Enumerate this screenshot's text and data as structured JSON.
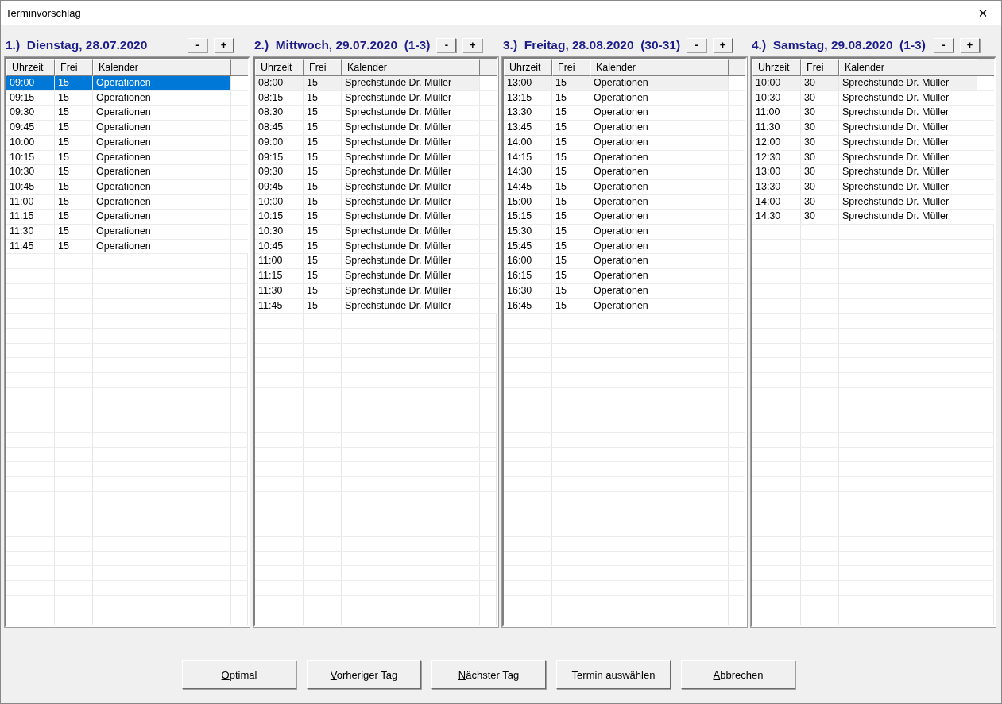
{
  "window": {
    "title": "Terminvorschlag",
    "close": "✕"
  },
  "days": [
    {
      "number": "1.)",
      "title": "Dienstag, 28.07.2020",
      "active": true,
      "minus": "-",
      "plus": "+",
      "columns": [
        "Uhrzeit",
        "Frei",
        "Kalender"
      ],
      "rows": [
        {
          "time": "09:00",
          "free": "15",
          "calendar": "Operationen",
          "selected": true
        },
        {
          "time": "09:15",
          "free": "15",
          "calendar": "Operationen",
          "selected": false
        },
        {
          "time": "09:30",
          "free": "15",
          "calendar": "Operationen",
          "selected": false
        },
        {
          "time": "09:45",
          "free": "15",
          "calendar": "Operationen",
          "selected": false
        },
        {
          "time": "10:00",
          "free": "15",
          "calendar": "Operationen",
          "selected": false
        },
        {
          "time": "10:15",
          "free": "15",
          "calendar": "Operationen",
          "selected": false
        },
        {
          "time": "10:30",
          "free": "15",
          "calendar": "Operationen",
          "selected": false
        },
        {
          "time": "10:45",
          "free": "15",
          "calendar": "Operationen",
          "selected": false
        },
        {
          "time": "11:00",
          "free": "15",
          "calendar": "Operationen",
          "selected": false
        },
        {
          "time": "11:15",
          "free": "15",
          "calendar": "Operationen",
          "selected": false
        },
        {
          "time": "11:30",
          "free": "15",
          "calendar": "Operationen",
          "selected": false
        },
        {
          "time": "11:45",
          "free": "15",
          "calendar": "Operationen",
          "selected": false
        }
      ]
    },
    {
      "number": "2.)",
      "title": "Mittwoch, 29.07.2020",
      "range": "(1-3)",
      "active": false,
      "minus": "-",
      "plus": "+",
      "columns": [
        "Uhrzeit",
        "Frei",
        "Kalender"
      ],
      "rows": [
        {
          "time": "08:00",
          "free": "15",
          "calendar": "Sprechstunde Dr. Müller",
          "selected": true
        },
        {
          "time": "08:15",
          "free": "15",
          "calendar": "Sprechstunde Dr. Müller",
          "selected": false
        },
        {
          "time": "08:30",
          "free": "15",
          "calendar": "Sprechstunde Dr. Müller",
          "selected": false
        },
        {
          "time": "08:45",
          "free": "15",
          "calendar": "Sprechstunde Dr. Müller",
          "selected": false
        },
        {
          "time": "09:00",
          "free": "15",
          "calendar": "Sprechstunde Dr. Müller",
          "selected": false
        },
        {
          "time": "09:15",
          "free": "15",
          "calendar": "Sprechstunde Dr. Müller",
          "selected": false
        },
        {
          "time": "09:30",
          "free": "15",
          "calendar": "Sprechstunde Dr. Müller",
          "selected": false
        },
        {
          "time": "09:45",
          "free": "15",
          "calendar": "Sprechstunde Dr. Müller",
          "selected": false
        },
        {
          "time": "10:00",
          "free": "15",
          "calendar": "Sprechstunde Dr. Müller",
          "selected": false
        },
        {
          "time": "10:15",
          "free": "15",
          "calendar": "Sprechstunde Dr. Müller",
          "selected": false
        },
        {
          "time": "10:30",
          "free": "15",
          "calendar": "Sprechstunde Dr. Müller",
          "selected": false
        },
        {
          "time": "10:45",
          "free": "15",
          "calendar": "Sprechstunde Dr. Müller",
          "selected": false
        },
        {
          "time": "11:00",
          "free": "15",
          "calendar": "Sprechstunde Dr. Müller",
          "selected": false
        },
        {
          "time": "11:15",
          "free": "15",
          "calendar": "Sprechstunde Dr. Müller",
          "selected": false
        },
        {
          "time": "11:30",
          "free": "15",
          "calendar": "Sprechstunde Dr. Müller",
          "selected": false
        },
        {
          "time": "11:45",
          "free": "15",
          "calendar": "Sprechstunde Dr. Müller",
          "selected": false
        }
      ]
    },
    {
      "number": "3.)",
      "title": "Freitag, 28.08.2020",
      "range": "(30-31)",
      "active": false,
      "minus": "-",
      "plus": "+",
      "columns": [
        "Uhrzeit",
        "Frei",
        "Kalender"
      ],
      "rows": [
        {
          "time": "13:00",
          "free": "15",
          "calendar": "Operationen",
          "selected": true
        },
        {
          "time": "13:15",
          "free": "15",
          "calendar": "Operationen",
          "selected": false
        },
        {
          "time": "13:30",
          "free": "15",
          "calendar": "Operationen",
          "selected": false
        },
        {
          "time": "13:45",
          "free": "15",
          "calendar": "Operationen",
          "selected": false
        },
        {
          "time": "14:00",
          "free": "15",
          "calendar": "Operationen",
          "selected": false
        },
        {
          "time": "14:15",
          "free": "15",
          "calendar": "Operationen",
          "selected": false
        },
        {
          "time": "14:30",
          "free": "15",
          "calendar": "Operationen",
          "selected": false
        },
        {
          "time": "14:45",
          "free": "15",
          "calendar": "Operationen",
          "selected": false
        },
        {
          "time": "15:00",
          "free": "15",
          "calendar": "Operationen",
          "selected": false
        },
        {
          "time": "15:15",
          "free": "15",
          "calendar": "Operationen",
          "selected": false
        },
        {
          "time": "15:30",
          "free": "15",
          "calendar": "Operationen",
          "selected": false
        },
        {
          "time": "15:45",
          "free": "15",
          "calendar": "Operationen",
          "selected": false
        },
        {
          "time": "16:00",
          "free": "15",
          "calendar": "Operationen",
          "selected": false
        },
        {
          "time": "16:15",
          "free": "15",
          "calendar": "Operationen",
          "selected": false
        },
        {
          "time": "16:30",
          "free": "15",
          "calendar": "Operationen",
          "selected": false
        },
        {
          "time": "16:45",
          "free": "15",
          "calendar": "Operationen",
          "selected": false
        }
      ]
    },
    {
      "number": "4.)",
      "title": "Samstag, 29.08.2020",
      "range": "(1-3)",
      "active": false,
      "minus": "-",
      "plus": "+",
      "columns": [
        "Uhrzeit",
        "Frei",
        "Kalender"
      ],
      "rows": [
        {
          "time": "10:00",
          "free": "30",
          "calendar": "Sprechstunde Dr. Müller",
          "selected": true
        },
        {
          "time": "10:30",
          "free": "30",
          "calendar": "Sprechstunde Dr. Müller",
          "selected": false
        },
        {
          "time": "11:00",
          "free": "30",
          "calendar": "Sprechstunde Dr. Müller",
          "selected": false
        },
        {
          "time": "11:30",
          "free": "30",
          "calendar": "Sprechstunde Dr. Müller",
          "selected": false
        },
        {
          "time": "12:00",
          "free": "30",
          "calendar": "Sprechstunde Dr. Müller",
          "selected": false
        },
        {
          "time": "12:30",
          "free": "30",
          "calendar": "Sprechstunde Dr. Müller",
          "selected": false
        },
        {
          "time": "13:00",
          "free": "30",
          "calendar": "Sprechstunde Dr. Müller",
          "selected": false
        },
        {
          "time": "13:30",
          "free": "30",
          "calendar": "Sprechstunde Dr. Müller",
          "selected": false
        },
        {
          "time": "14:00",
          "free": "30",
          "calendar": "Sprechstunde Dr. Müller",
          "selected": false
        },
        {
          "time": "14:30",
          "free": "30",
          "calendar": "Sprechstunde Dr. Müller",
          "selected": false
        }
      ]
    }
  ],
  "buttons": [
    {
      "label": "Optimal",
      "mnemonic": true
    },
    {
      "label": "Vorheriger Tag",
      "mnemonic": true
    },
    {
      "label": "Nächster Tag",
      "mnemonic": true
    },
    {
      "label": "Termin auswählen",
      "mnemonic": false
    },
    {
      "label": "Abbrechen",
      "mnemonic": true
    }
  ]
}
